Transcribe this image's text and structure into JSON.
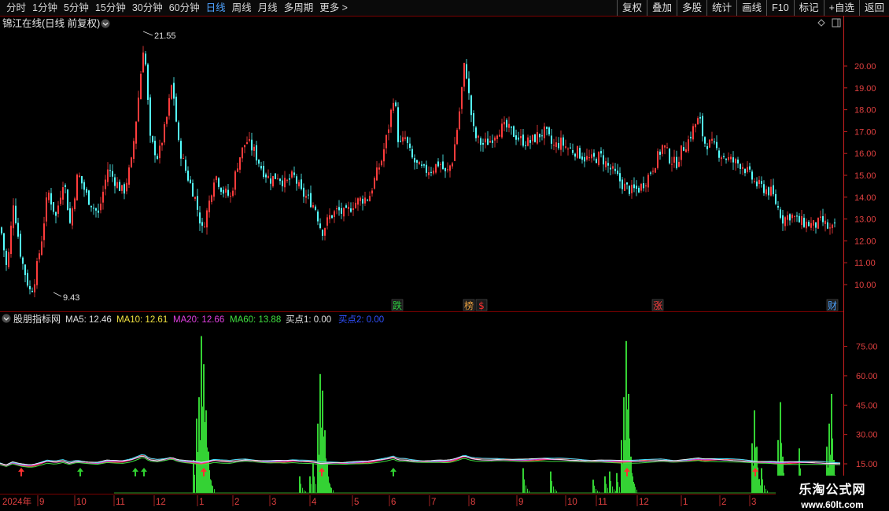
{
  "toolbar": {
    "periods": [
      {
        "label": "分时",
        "name": "tab-intraday"
      },
      {
        "label": "1分钟",
        "name": "tab-1min"
      },
      {
        "label": "5分钟",
        "name": "tab-5min"
      },
      {
        "label": "15分钟",
        "name": "tab-15min"
      },
      {
        "label": "30分钟",
        "name": "tab-30min"
      },
      {
        "label": "60分钟",
        "name": "tab-60min"
      },
      {
        "label": "日线",
        "name": "tab-daily",
        "active": true
      },
      {
        "label": "周线",
        "name": "tab-weekly"
      },
      {
        "label": "月线",
        "name": "tab-monthly"
      },
      {
        "label": "多周期",
        "name": "tab-multi-period"
      },
      {
        "label": "更多 >",
        "name": "tab-more"
      }
    ],
    "buttons": [
      {
        "label": "复权",
        "name": "adjust-button"
      },
      {
        "label": "叠加",
        "name": "overlay-button"
      },
      {
        "label": "多股",
        "name": "multi-stock-button"
      },
      {
        "label": "统计",
        "name": "statistics-button"
      },
      {
        "label": "画线",
        "name": "draw-line-button"
      },
      {
        "label": "F10",
        "name": "f10-button"
      },
      {
        "label": "标记",
        "name": "mark-button"
      },
      {
        "label": "+自选",
        "name": "add-watchlist-button"
      },
      {
        "label": "返回",
        "name": "back-button"
      }
    ]
  },
  "main_chart": {
    "stock_title": "锦江在线(日线 前复权)",
    "high_label": "21.55",
    "low_label": "9.43",
    "price_axis": [
      "20.00",
      "19.00",
      "18.00",
      "17.00",
      "16.00",
      "15.00",
      "14.00",
      "13.00",
      "12.00",
      "11.00",
      "10.00"
    ],
    "event_markers": [
      {
        "label": "跌",
        "name": "event-marker-drop",
        "color": "#2ecc40"
      },
      {
        "label": "榜",
        "name": "event-marker-list",
        "color": "#e8a040"
      },
      {
        "label": "$",
        "name": "event-marker-dollar",
        "color": "#ff3030"
      },
      {
        "label": "涨",
        "name": "event-marker-rise",
        "color": "#ff4040"
      },
      {
        "label": "财",
        "name": "event-marker-finance",
        "color": "#4fa3ff"
      }
    ]
  },
  "indicator_panel": {
    "name": "股朋指标网",
    "legend": [
      {
        "label": "MA5: 12.46",
        "color": "#e0e0e0"
      },
      {
        "label": "MA10: 12.61",
        "color": "#f0e040"
      },
      {
        "label": "MA20: 12.66",
        "color": "#e040e0"
      },
      {
        "label": "MA60: 13.88",
        "color": "#40e040"
      },
      {
        "label": "买点1: 0.00",
        "color": "#e0e0e0"
      },
      {
        "label": "买点2: 0.00",
        "color": "#3050ff"
      }
    ],
    "axis": [
      "75.00",
      "60.00",
      "45.00",
      "30.00",
      "15.00"
    ]
  },
  "time_axis": [
    "2024年",
    "9",
    "10",
    "11",
    "12",
    "1",
    "2",
    "3",
    "4",
    "5",
    "6",
    "7",
    "8",
    "9",
    "10",
    "11",
    "12",
    "1",
    "2",
    "3"
  ],
  "colors": {
    "up": "#ff3c3c",
    "down": "#54ffff",
    "grid": "#7a0000",
    "axis": "#ff4040",
    "volume": "#34d234"
  },
  "watermark": {
    "title": "乐淘公式网",
    "url": "www.60lt.com"
  }
}
